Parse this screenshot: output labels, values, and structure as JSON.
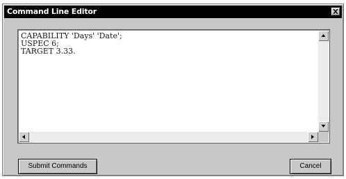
{
  "window": {
    "title": "Command Line Editor"
  },
  "editor": {
    "lines": [
      "CAPABILITY 'Days' 'Date';",
      "USPEC 6;",
      "TARGET 3.33."
    ]
  },
  "buttons": {
    "submit_label": "Submit Commands",
    "cancel_label": "Cancel"
  },
  "icons": {
    "close": "close-icon",
    "scroll_up": "scroll-up-arrow-icon",
    "scroll_down": "scroll-down-arrow-icon",
    "scroll_left": "scroll-left-arrow-icon",
    "scroll_right": "scroll-right-arrow-icon"
  },
  "colors": {
    "titlebar": "#000000",
    "title_text": "#ffffff",
    "dialog_face": "#c8c8c8",
    "editor_background": "#ffffff"
  }
}
